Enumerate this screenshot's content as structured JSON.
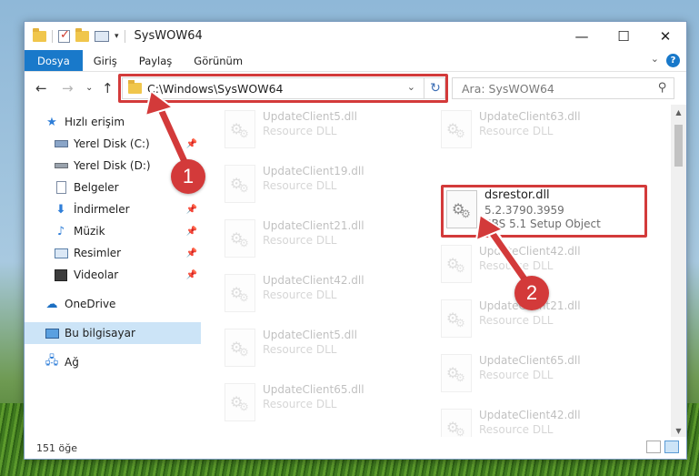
{
  "window": {
    "title": "SysWOW64"
  },
  "ribbon": {
    "tabs": [
      "Dosya",
      "Giriş",
      "Paylaş",
      "Görünüm"
    ],
    "help": "?"
  },
  "address": {
    "path": "C:\\Windows\\SysWOW64"
  },
  "search": {
    "placeholder": "Ara: SysWOW64"
  },
  "nav": {
    "quick_access": "Hızlı erişim",
    "items": [
      {
        "label": "Yerel Disk (C:)",
        "pinned": true
      },
      {
        "label": "Yerel Disk (D:)",
        "pinned": true
      },
      {
        "label": "Belgeler",
        "pinned": true
      },
      {
        "label": "İndirmeler",
        "pinned": true
      },
      {
        "label": "Müzik",
        "pinned": true
      },
      {
        "label": "Resimler",
        "pinned": true
      },
      {
        "label": "Videolar",
        "pinned": true
      }
    ],
    "onedrive": "OneDrive",
    "this_pc": "Bu bilgisayar",
    "network": "Ağ"
  },
  "files": {
    "left": [
      {
        "name": "UpdateClient5.dll",
        "desc": "Resource DLL"
      },
      {
        "name": "UpdateClient19.dll",
        "desc": "Resource DLL"
      },
      {
        "name": "UpdateClient21.dll",
        "desc": "Resource DLL"
      },
      {
        "name": "UpdateClient42.dll",
        "desc": "Resource DLL"
      },
      {
        "name": "UpdateClient5.dll",
        "desc": "Resource DLL"
      },
      {
        "name": "UpdateClient65.dll",
        "desc": "Resource DLL"
      }
    ],
    "right": [
      {
        "name": "UpdateClient63.dll",
        "desc": "Resource DLL"
      },
      {
        "name": "UpdateClient42.dll",
        "desc": "Resource DLL"
      },
      {
        "name": "UpdateClient21.dll",
        "desc": "Resource DLL"
      },
      {
        "name": "UpdateClient65.dll",
        "desc": "Resource DLL"
      },
      {
        "name": "UpdateClient42.dll",
        "desc": "Resource DLL"
      }
    ],
    "highlighted": {
      "name": "dsrestor.dll",
      "version": "5.2.3790.3959",
      "desc": "SBS 5.1 Setup Object"
    }
  },
  "status": {
    "count": "151 öğe"
  },
  "callouts": [
    "1",
    "2"
  ],
  "colors": {
    "accent": "#1979ca",
    "highlight": "#d33a3a",
    "selected": "#cce4f7"
  }
}
